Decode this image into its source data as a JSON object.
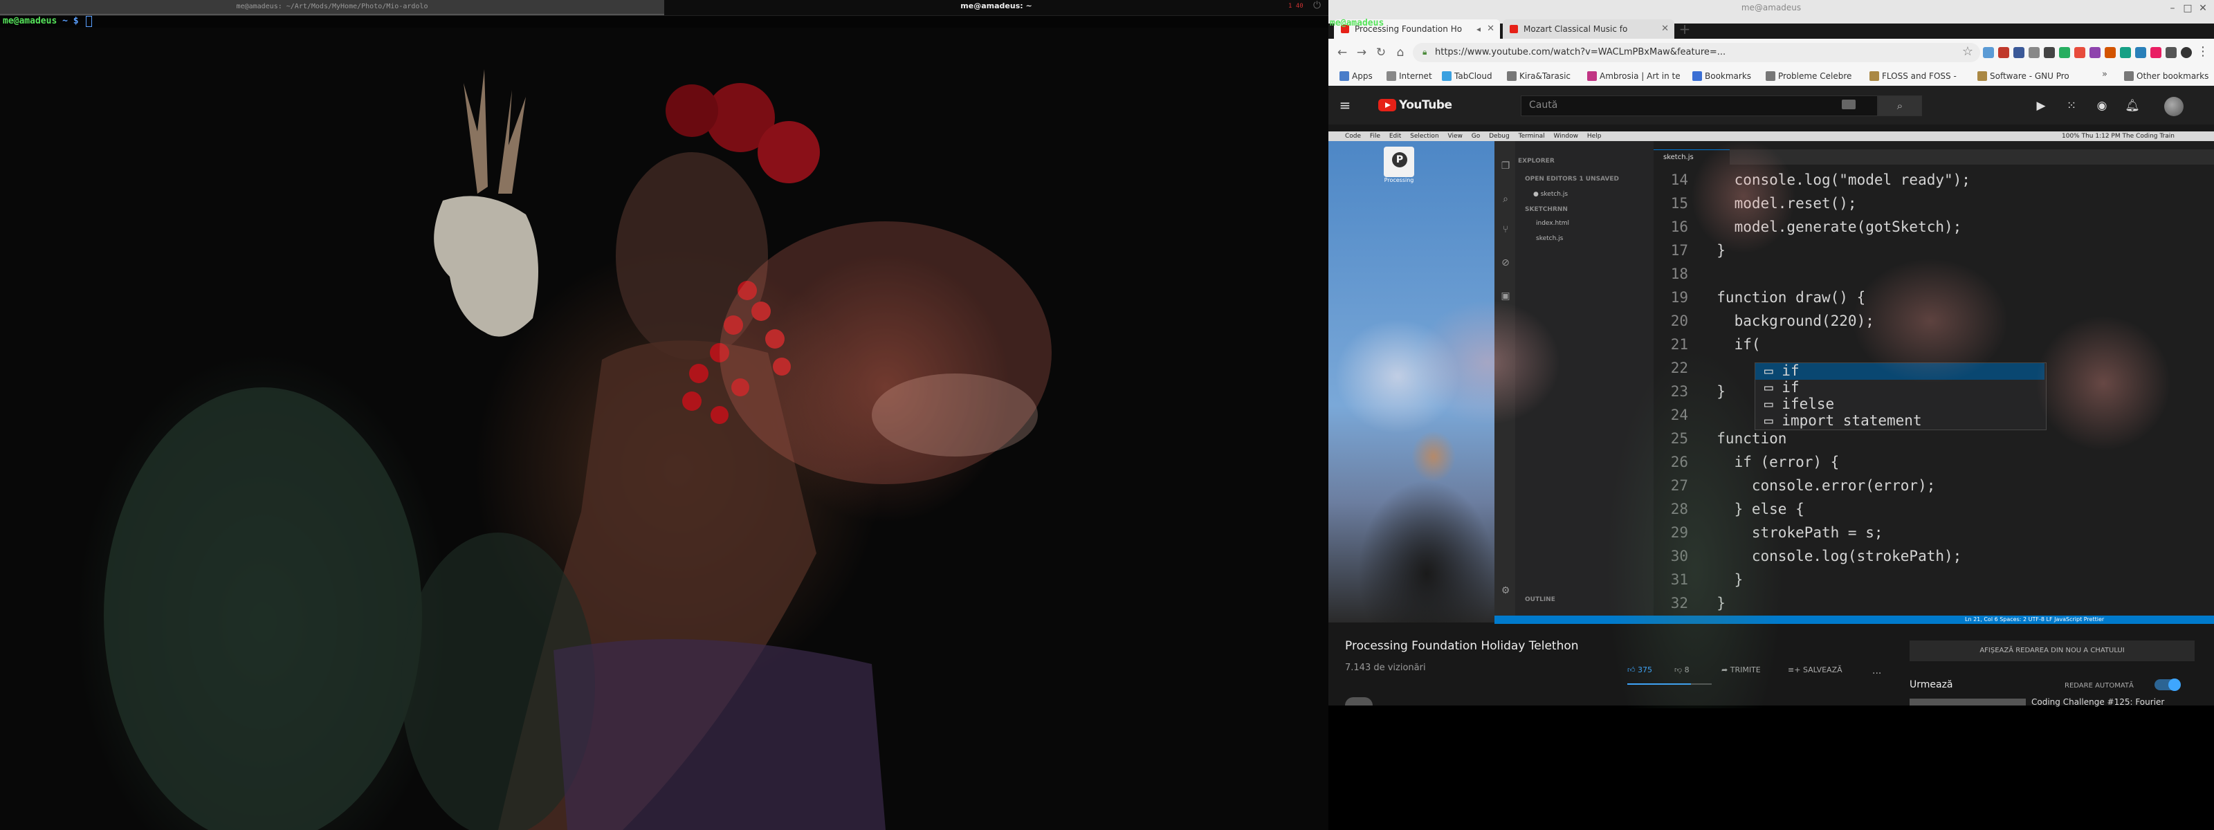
{
  "left": {
    "terminal_tab_title": "me@amadeus: ~/Art/Mods/MyHome/Photo/Mio-ardolo",
    "wm_title": "me@amadeus: ~",
    "status": "1 40",
    "prompt_user": "me@amadeus",
    "prompt_path": "~",
    "prompt_symbol": "$"
  },
  "right": {
    "workspace_label": "me@amadeus",
    "window_title": "me@amadeus",
    "tabs": [
      {
        "label": "Processing Foundation Ho",
        "icon_color": "#e62117"
      },
      {
        "label": "Mozart Classical Music fo",
        "icon_color": "#e62117"
      }
    ],
    "url": "https://www.youtube.com/watch?v=WACLmPBxMaw&feature=...",
    "bookmarks": [
      "Apps",
      "Internet",
      "TabCloud",
      "Kira&Tarasic",
      "Ambrosia | Art in te",
      "Bookmarks",
      "Probleme Celebre",
      "FLOSS and FOSS -",
      "Software - GNU Pro",
      "Other bookmarks"
    ],
    "youtube": {
      "logo_text": "YouTube",
      "search_placeholder": "Caută",
      "video_title": "Processing Foundation Holiday Telethon",
      "views": "7.143 de vizionări",
      "likes": "375",
      "dislikes": "8",
      "share": "TRIMITE",
      "save": "SALVEAZĂ",
      "more": "...",
      "show_chat": "AFIȘEAZĂ REDAREA DIN NOU A CHATULUI",
      "up_next": "Urmează",
      "autoplay": "REDARE AUTOMATĂ",
      "next_video": "Coding Challenge #125: Fourier"
    },
    "video": {
      "mac_menu": [
        "Code",
        "File",
        "Edit",
        "Selection",
        "View",
        "Go",
        "Debug",
        "Terminal",
        "Window",
        "Help"
      ],
      "mac_right": "100%  Thu 1:12 PM   The Coding Train",
      "p5_caption": "Processing",
      "editor_tab": "sketch.js",
      "sidebar": [
        "EXPLORER",
        "OPEN EDITORS  1 UNSAVED",
        "● sketch.js",
        "SKETCHRNN",
        "index.html",
        "sketch.js",
        "OUTLINE"
      ],
      "line_numbers": [
        "14",
        "15",
        "16",
        "17",
        "18",
        "19",
        "20",
        "21",
        "22",
        "23",
        "24",
        "25",
        "26",
        "27",
        "28",
        "29",
        "30",
        "31",
        "32"
      ],
      "code": [
        "    console.log(\"model ready\");",
        "    model.reset();",
        "    model.generate(gotSketch);",
        "  }",
        "",
        "  function draw() {",
        "    background(220);",
        "    if(",
        "",
        "  }",
        "",
        "  function",
        "    if (error) {",
        "      console.error(error);",
        "    } else {",
        "      strokePath = s;",
        "      console.log(strokePath);",
        "    }",
        "  }"
      ],
      "suggestions": [
        "if",
        "if",
        "ifelse",
        "import statement"
      ],
      "status_bar": "Ln 21, Col 6   Spaces: 2   UTF-8   LF   JavaScript   Prettier"
    }
  }
}
